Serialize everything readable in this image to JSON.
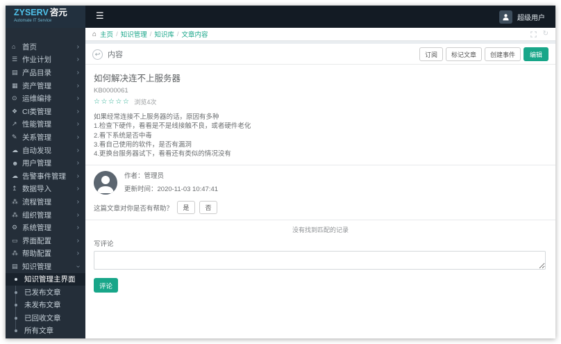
{
  "brand": {
    "name": "ZYSERV",
    "name_cn": "咨元",
    "tagline": "Automate IT Service"
  },
  "topbar": {
    "user": "超级用户"
  },
  "icons": {
    "hamburger": "☰",
    "home": "⌂",
    "tasks": "☰",
    "catalog": "▤",
    "asset": "▦",
    "ops": "⊙",
    "ci": "❖",
    "perf": "↗",
    "relation": "✎",
    "discovery": "☁",
    "users": "☻",
    "alert": "☁",
    "import": "↥",
    "flow": "⁂",
    "org": "⁂",
    "system": "⚙",
    "ui": "▭",
    "help": "⁂",
    "knowledge": "▤",
    "chevron_right": "›",
    "back": "↩",
    "refresh": "↻",
    "bc_home": "⌂"
  },
  "sidebar": {
    "items": [
      {
        "label": "首页",
        "icon": "home"
      },
      {
        "label": "作业计划",
        "icon": "tasks"
      },
      {
        "label": "产品目录",
        "icon": "catalog"
      },
      {
        "label": "资产管理",
        "icon": "asset"
      },
      {
        "label": "运维编排",
        "icon": "ops"
      },
      {
        "label": "CI类管理",
        "icon": "ci"
      },
      {
        "label": "性能管理",
        "icon": "perf"
      },
      {
        "label": "关系管理",
        "icon": "relation"
      },
      {
        "label": "自动发现",
        "icon": "discovery"
      },
      {
        "label": "用户管理",
        "icon": "users"
      },
      {
        "label": "告警事件管理",
        "icon": "alert"
      },
      {
        "label": "数据导入",
        "icon": "import"
      },
      {
        "label": "流程管理",
        "icon": "flow"
      },
      {
        "label": "组织管理",
        "icon": "org"
      },
      {
        "label": "系统管理",
        "icon": "system"
      },
      {
        "label": "界面配置",
        "icon": "ui"
      },
      {
        "label": "帮助配置",
        "icon": "help"
      },
      {
        "label": "知识管理",
        "icon": "knowledge",
        "expanded": true
      }
    ],
    "submenu": [
      {
        "label": "知识管理主界面",
        "active": true
      },
      {
        "label": "已发布文章"
      },
      {
        "label": "未发布文章"
      },
      {
        "label": "已回收文章"
      },
      {
        "label": "所有文章"
      }
    ]
  },
  "breadcrumb": {
    "separator": "/",
    "items": [
      "主页",
      "知识管理",
      "知识库",
      "文章内容"
    ]
  },
  "content": {
    "panel_title": "内容",
    "actions": {
      "subscribe": "订阅",
      "mark": "标记文章",
      "create_event": "创建事件",
      "edit": "编辑"
    },
    "article": {
      "title": "如何解决连不上服务器",
      "kb_id": "KB0000061",
      "stars": "☆☆☆☆☆",
      "views": "浏览4次",
      "body_lines": [
        "如果经常连接不上服务器的话，原因有多种",
        "1.检查下硬件，看看是不是线接触不良，或者硬件老化",
        "2.看下系统是否中毒",
        "3.看自己使用的软件，是否有漏洞",
        "4.更换台服务器试下，看看还有类似的情况没有"
      ]
    },
    "author": {
      "name_line": "作者：管理员",
      "updated_line": "更新时间：2020-11-03 10:47:41"
    },
    "helpful": {
      "question": "这篇文章对你是否有帮助？",
      "yes": "是",
      "no": "否"
    },
    "comments": {
      "empty": "没有找到匹配的记录",
      "write_label": "写评论",
      "submit": "评论"
    }
  },
  "colors": {
    "accent": "#18a689",
    "sidebar_bg": "#242e39",
    "navbar_bg": "#131b24"
  }
}
